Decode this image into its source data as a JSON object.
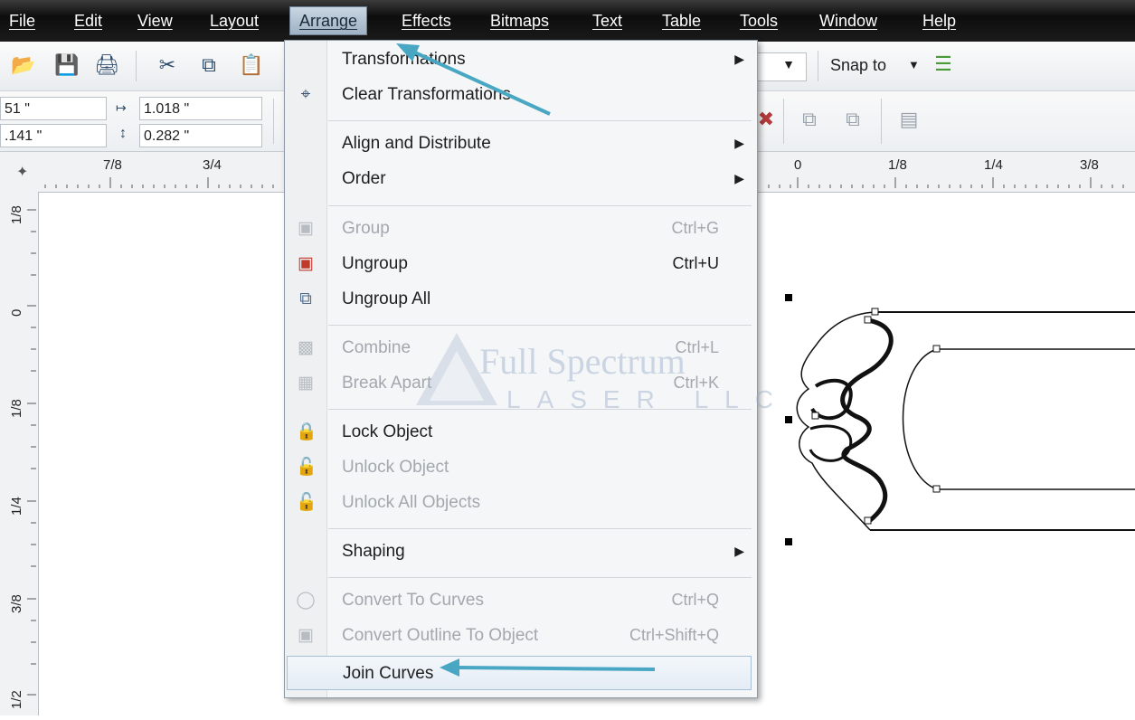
{
  "menubar": [
    {
      "label": "File"
    },
    {
      "label": "Edit"
    },
    {
      "label": "View"
    },
    {
      "label": "Layout"
    },
    {
      "label": "Arrange"
    },
    {
      "label": "Effects"
    },
    {
      "label": "Bitmaps"
    },
    {
      "label": "Text"
    },
    {
      "label": "Table"
    },
    {
      "label": "Tools"
    },
    {
      "label": "Window"
    },
    {
      "label": "Help"
    }
  ],
  "toolbar": {
    "snap_label": "Snap to",
    "x_value": "51 \"",
    "y_value": ".141 \"",
    "width_value": "1.018 \"",
    "height_value": "0.282 \""
  },
  "ruler": {
    "h_labels": [
      "7/8",
      "3/4",
      "0",
      "1/8",
      "1/4",
      "3/8"
    ],
    "v_labels": [
      "1/8",
      "0",
      "1/8",
      "1/4",
      "3/8",
      "1/2"
    ]
  },
  "menu": {
    "transformations": "Transformations",
    "clear_transformations": "Clear Transformations",
    "align_distribute": "Align and Distribute",
    "order": "Order",
    "group": "Group",
    "group_shortcut": "Ctrl+G",
    "ungroup": "Ungroup",
    "ungroup_shortcut": "Ctrl+U",
    "ungroup_all": "Ungroup All",
    "combine": "Combine",
    "combine_shortcut": "Ctrl+L",
    "break_apart": "Break Apart",
    "break_apart_shortcut": "Ctrl+K",
    "lock_object": "Lock Object",
    "unlock_object": "Unlock Object",
    "unlock_all": "Unlock All Objects",
    "shaping": "Shaping",
    "convert_curves": "Convert To Curves",
    "convert_curves_shortcut": "Ctrl+Q",
    "convert_outline": "Convert Outline To Object",
    "convert_outline_shortcut": "Ctrl+Shift+Q",
    "join_curves": "Join Curves"
  },
  "watermark": {
    "line1": "Full Spectrum",
    "line2": "LASER LLC"
  },
  "colors": {
    "menubar": "#141414",
    "arrow": "#4aa7c4",
    "highlight": "#dfe8f2"
  }
}
